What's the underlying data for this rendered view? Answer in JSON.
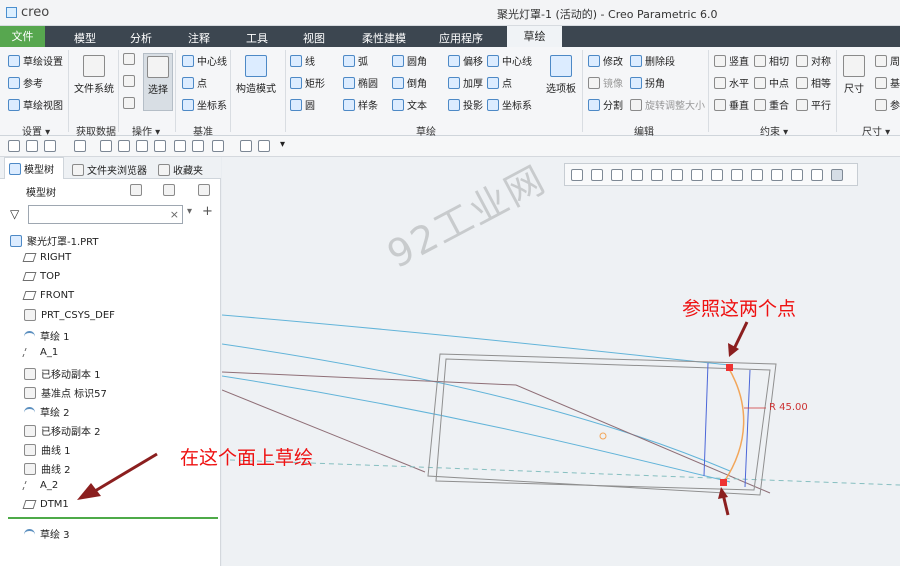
{
  "window": {
    "logo_text": "creo",
    "title": "聚光灯罩-1 (活动的) - Creo Parametric 6.0"
  },
  "menu": [
    "文件",
    "模型",
    "分析",
    "注释",
    "工具",
    "视图",
    "柔性建模",
    "应用程序",
    "草绘"
  ],
  "ribbon": {
    "setup": [
      "草绘设置",
      "参考",
      "草绘视图"
    ],
    "file_system": "文件系统",
    "select": "选择",
    "datum": [
      "中心线",
      "点",
      "坐标系"
    ],
    "construction_mode": "构造模式",
    "sketch": [
      "线",
      "弧",
      "圆角",
      "偏移",
      "中心线",
      "矩形",
      "椭圆",
      "倒角",
      "加厚",
      "点",
      "圆",
      "样条",
      "文本",
      "投影",
      "坐标系"
    ],
    "palette": "选项板",
    "edit": [
      "修改",
      "删除段",
      "镜像",
      "拐角",
      "分割",
      "旋转调整大小"
    ],
    "constraint": [
      "竖直",
      "相切",
      "对称",
      "水平",
      "中点",
      "相等",
      "垂直",
      "重合",
      "平行"
    ],
    "dimension": "尺寸",
    "right_partial": [
      "周",
      "基",
      "参"
    ],
    "groups": [
      "设置",
      "获取数据",
      "操作",
      "基准",
      "草绘",
      "编辑",
      "约束",
      "尺寸"
    ]
  },
  "panel": {
    "tabs": [
      "模型树",
      "文件夹浏览器",
      "收藏夹"
    ],
    "tree_header": "模型树",
    "filter_placeholder": ""
  },
  "tree": [
    {
      "label": "聚光灯罩-1.PRT"
    },
    {
      "label": "RIGHT"
    },
    {
      "label": "TOP"
    },
    {
      "label": "FRONT"
    },
    {
      "label": "PRT_CSYS_DEF"
    },
    {
      "label": "草绘 1"
    },
    {
      "label": "A_1"
    },
    {
      "label": "已移动副本 1"
    },
    {
      "label": "基准点 标识57"
    },
    {
      "label": "草绘 2"
    },
    {
      "label": "已移动副本 2"
    },
    {
      "label": "曲线 1"
    },
    {
      "label": "曲线 2"
    },
    {
      "label": "A_2"
    },
    {
      "label": "DTM1"
    },
    {
      "label": "草绘 3"
    }
  ],
  "canvas": {
    "dimension_label": "R 45.00",
    "watermark": "92工业网",
    "annotation_top": "参照这两个点",
    "annotation_left": "在这个面上草绘"
  }
}
